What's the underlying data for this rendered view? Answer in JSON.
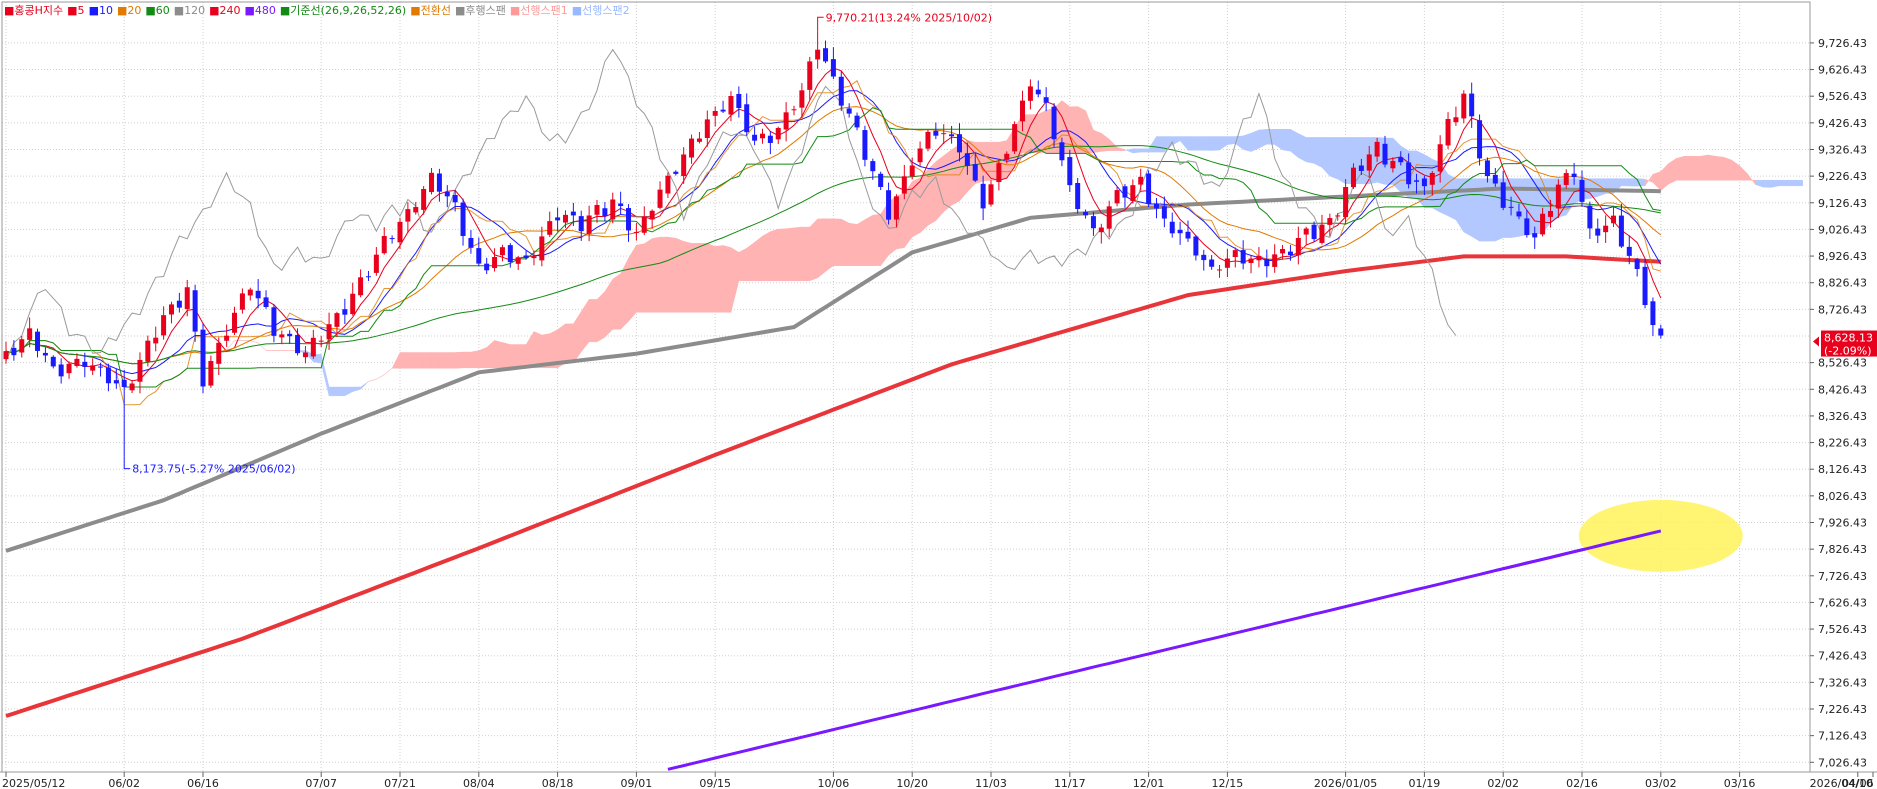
{
  "legend": [
    {
      "label": "홍콩H지수",
      "color": "#e8001c"
    },
    {
      "label": "5",
      "color": "#e8001c"
    },
    {
      "label": "10",
      "color": "#1a1aff"
    },
    {
      "label": "20",
      "color": "#e07a00"
    },
    {
      "label": "60",
      "color": "#138a13"
    },
    {
      "label": "120",
      "color": "#8c8c8c"
    },
    {
      "label": "240",
      "color": "#e8001c"
    },
    {
      "label": "480",
      "color": "#7a18ff"
    },
    {
      "label": "기준선(26,9,26,52,26)",
      "color": "#138a13"
    },
    {
      "label": "전환선",
      "color": "#e07a00"
    },
    {
      "label": "후행스팬",
      "color": "#8c8c8c"
    },
    {
      "label": "선행스팬1",
      "color": "#ff9a9a"
    },
    {
      "label": "선행스팬2",
      "color": "#9ab8ff"
    }
  ],
  "colors": {
    "up": "#e8001c",
    "down": "#1a1aff",
    "ma5": "#e8001c",
    "ma10": "#1a1aff",
    "ma20": "#e07a00",
    "ma60": "#138a13",
    "ma120": "#8c8c8c",
    "ma240": "#e8353a",
    "ma480": "#7a18ff",
    "kijun": "#138a13",
    "tenkan": "#e07a00",
    "chikou": "#9a9a9a",
    "cloud_bull": "#ffb3b3",
    "cloud_bear": "#b3c8ff",
    "grid": "#d0d0d0",
    "highlight": "#fff35a"
  },
  "chart_data": {
    "type": "candlestick",
    "y_ticks": [
      "7,026.43",
      "7,126.43",
      "7,226.43",
      "7,326.43",
      "7,426.43",
      "7,526.43",
      "7,626.43",
      "7,726.43",
      "7,826.43",
      "7,926.43",
      "8,026.43",
      "8,126.43",
      "8,226.43",
      "8,326.43",
      "8,426.43",
      "8,526.43",
      "8,626.43",
      "8,726.43",
      "8,826.43",
      "8,926.43",
      "9,026.43",
      "9,126.43",
      "9,226.43",
      "9,326.43",
      "9,426.43",
      "9,526.43",
      "9,626.43",
      "9,726.43"
    ],
    "ylim": [
      6990,
      9880
    ],
    "x_ticks": [
      "2025/05/12",
      "06/02",
      "06/16",
      "07/07",
      "07/21",
      "08/04",
      "08/18",
      "09/01",
      "09/15",
      "10/06",
      "10/20",
      "11/03",
      "11/17",
      "12/01",
      "12/15",
      "2026/01/05",
      "01/19",
      "02/02",
      "02/16",
      "03/02",
      "03/16",
      "04/06",
      "2026/04/10"
    ],
    "x_tick_index": [
      0,
      15,
      25,
      40,
      50,
      60,
      70,
      80,
      90,
      105,
      115,
      125,
      135,
      145,
      155,
      170,
      180,
      190,
      200,
      210,
      220,
      235,
      238
    ],
    "n_bars": 211,
    "annotations": {
      "high": {
        "label": "9,770.21(13.24% 2025/10/02)",
        "index": 103,
        "value": 9770.21
      },
      "low": {
        "label": "8,173.75(-5.27% 2025/06/02)",
        "index": 15,
        "value": 8173.75
      }
    },
    "current": {
      "value": 8628.13,
      "label": "8,628.13",
      "change": "(-2.09%)"
    },
    "close_anchors": [
      [
        0,
        8550
      ],
      [
        3,
        8640
      ],
      [
        6,
        8500
      ],
      [
        10,
        8530
      ],
      [
        15,
        8420
      ],
      [
        20,
        8700
      ],
      [
        23,
        8800
      ],
      [
        25,
        8460
      ],
      [
        28,
        8650
      ],
      [
        31,
        8820
      ],
      [
        34,
        8650
      ],
      [
        38,
        8560
      ],
      [
        42,
        8700
      ],
      [
        45,
        8820
      ],
      [
        48,
        8980
      ],
      [
        51,
        9080
      ],
      [
        54,
        9220
      ],
      [
        57,
        9110
      ],
      [
        60,
        8870
      ],
      [
        63,
        8940
      ],
      [
        66,
        8900
      ],
      [
        70,
        9090
      ],
      [
        73,
        9050
      ],
      [
        77,
        9130
      ],
      [
        80,
        9010
      ],
      [
        83,
        9170
      ],
      [
        86,
        9300
      ],
      [
        89,
        9430
      ],
      [
        92,
        9520
      ],
      [
        95,
        9350
      ],
      [
        98,
        9400
      ],
      [
        101,
        9540
      ],
      [
        103,
        9720
      ],
      [
        106,
        9520
      ],
      [
        109,
        9320
      ],
      [
        112,
        9080
      ],
      [
        115,
        9280
      ],
      [
        118,
        9410
      ],
      [
        121,
        9330
      ],
      [
        124,
        9120
      ],
      [
        127,
        9330
      ],
      [
        130,
        9580
      ],
      [
        132,
        9480
      ],
      [
        135,
        9180
      ],
      [
        138,
        9020
      ],
      [
        141,
        9150
      ],
      [
        144,
        9200
      ],
      [
        147,
        9050
      ],
      [
        150,
        8980
      ],
      [
        153,
        8870
      ],
      [
        156,
        8930
      ],
      [
        159,
        8900
      ],
      [
        162,
        8940
      ],
      [
        165,
        9010
      ],
      [
        168,
        9050
      ],
      [
        171,
        9240
      ],
      [
        174,
        9330
      ],
      [
        177,
        9250
      ],
      [
        180,
        9170
      ],
      [
        183,
        9420
      ],
      [
        185,
        9530
      ],
      [
        188,
        9220
      ],
      [
        191,
        9100
      ],
      [
        194,
        8990
      ],
      [
        197,
        9190
      ],
      [
        199,
        9240
      ],
      [
        201,
        9010
      ],
      [
        204,
        9050
      ],
      [
        207,
        8860
      ],
      [
        209,
        8660
      ],
      [
        211,
        8628
      ]
    ],
    "ma480": {
      "start_index": 84,
      "start_value": 7000,
      "end_value": 7895
    },
    "ma240": {
      "points": [
        [
          0,
          7200
        ],
        [
          30,
          7490
        ],
        [
          60,
          7830
        ],
        [
          90,
          8180
        ],
        [
          120,
          8520
        ],
        [
          150,
          8780
        ],
        [
          170,
          8870
        ],
        [
          185,
          8925
        ],
        [
          198,
          8925
        ],
        [
          210,
          8905
        ]
      ]
    },
    "ma120": {
      "points": [
        [
          0,
          7820
        ],
        [
          20,
          8010
        ],
        [
          40,
          8260
        ],
        [
          60,
          8490
        ],
        [
          80,
          8560
        ],
        [
          100,
          8660
        ],
        [
          115,
          8940
        ],
        [
          130,
          9070
        ],
        [
          150,
          9120
        ],
        [
          170,
          9150
        ],
        [
          190,
          9180
        ],
        [
          210,
          9170
        ]
      ]
    }
  }
}
